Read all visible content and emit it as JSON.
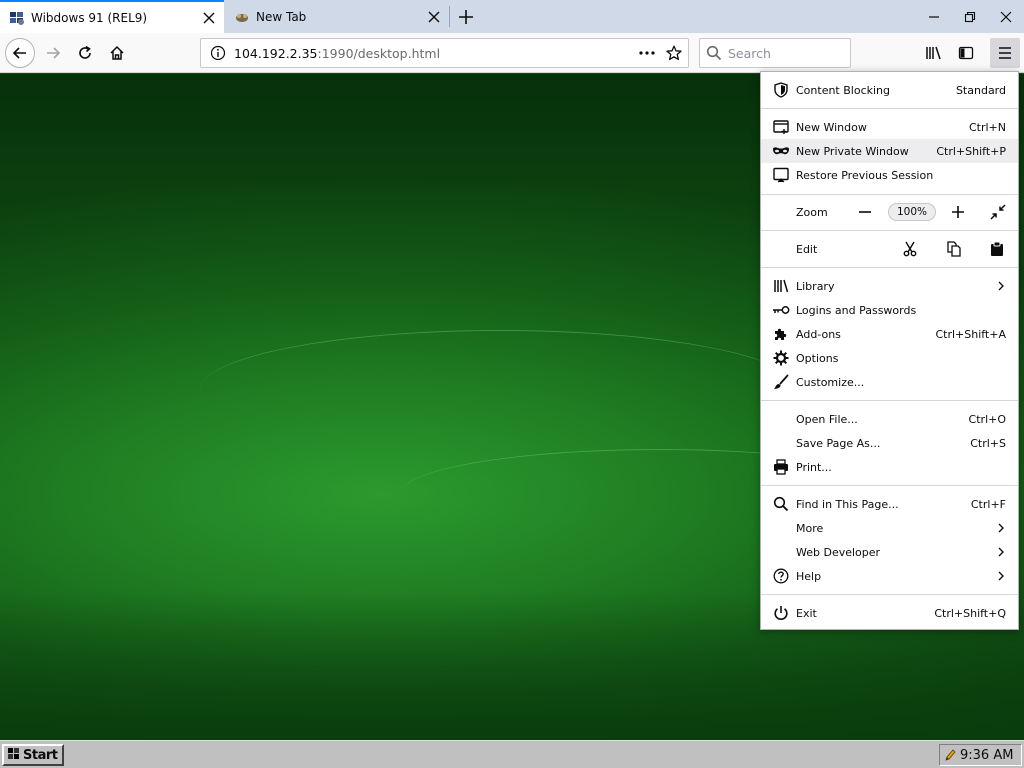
{
  "tabs": [
    {
      "title": "Wibdows 91 (REL9)",
      "active": true
    },
    {
      "title": "New Tab",
      "active": false
    }
  ],
  "navbar": {
    "url_host": "104.192.2.35",
    "url_rest": ":1990/desktop.html",
    "search_placeholder": "Search"
  },
  "menu": {
    "content_blocking": {
      "label": "Content Blocking",
      "value": "Standard"
    },
    "new_window": {
      "label": "New Window",
      "shortcut": "Ctrl+N"
    },
    "new_private_window": {
      "label": "New Private Window",
      "shortcut": "Ctrl+Shift+P"
    },
    "restore_session": {
      "label": "Restore Previous Session"
    },
    "zoom": {
      "label": "Zoom",
      "level": "100%"
    },
    "edit": {
      "label": "Edit"
    },
    "library": {
      "label": "Library"
    },
    "logins": {
      "label": "Logins and Passwords"
    },
    "addons": {
      "label": "Add-ons",
      "shortcut": "Ctrl+Shift+A"
    },
    "options": {
      "label": "Options"
    },
    "customize": {
      "label": "Customize..."
    },
    "open_file": {
      "label": "Open File...",
      "shortcut": "Ctrl+O"
    },
    "save_page": {
      "label": "Save Page As...",
      "shortcut": "Ctrl+S"
    },
    "print": {
      "label": "Print..."
    },
    "find": {
      "label": "Find in This Page...",
      "shortcut": "Ctrl+F"
    },
    "more": {
      "label": "More"
    },
    "web_developer": {
      "label": "Web Developer"
    },
    "help": {
      "label": "Help"
    },
    "exit": {
      "label": "Exit",
      "shortcut": "Ctrl+Shift+Q"
    }
  },
  "taskbar": {
    "start_label": "Start",
    "clock": "9:36 AM"
  },
  "colors": {
    "tabstrip": "#cfd9e8",
    "active_tab_accent": "#0a84ff",
    "desktop_green": "#1f7d22",
    "taskbar": "#c0c0c0"
  }
}
